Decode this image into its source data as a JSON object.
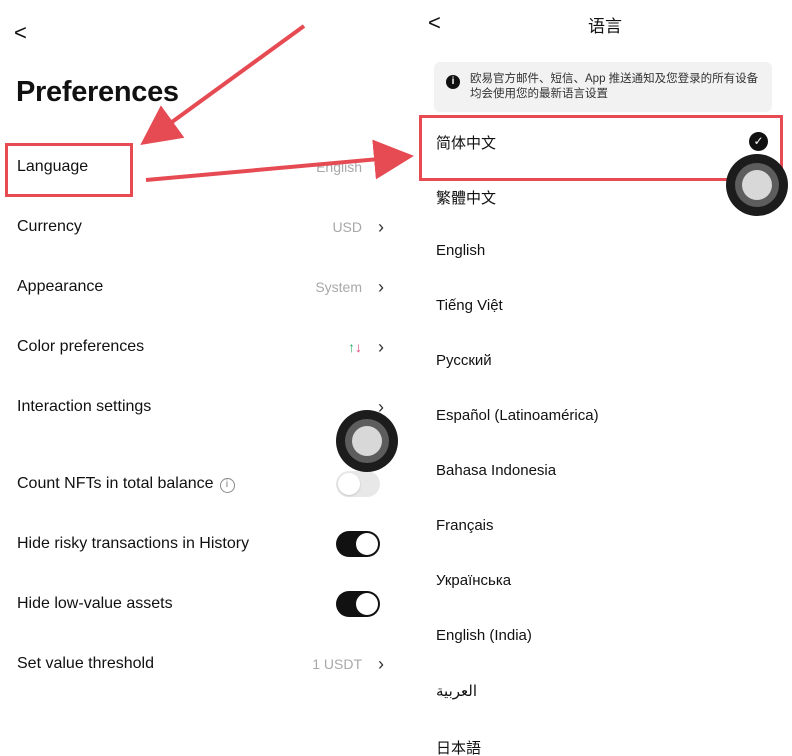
{
  "left": {
    "back_glyph": "<",
    "title": "Preferences",
    "rows": [
      {
        "label": "Language",
        "value": "English"
      },
      {
        "label": "Currency",
        "value": "USD"
      },
      {
        "label": "Appearance",
        "value": "System"
      },
      {
        "label": "Color preferences",
        "value_up": "↑",
        "value_down": "↓"
      },
      {
        "label": "Interaction settings"
      },
      {
        "label": "Count NFTs in total balance",
        "toggle": false
      },
      {
        "label": "Hide risky transactions in History",
        "toggle": true
      },
      {
        "label": "Hide low-value assets",
        "toggle": true
      },
      {
        "label": "Set value threshold",
        "value": "1 USDT"
      }
    ]
  },
  "right": {
    "back_glyph": "<",
    "title": "语言",
    "notice": "欧易官方邮件、短信、App 推送通知及您登录的所有设备均会使用您的最新语言设置",
    "languages": [
      "简体中文",
      "繁體中文",
      "English",
      "Tiếng Việt",
      "Русский",
      "Español (Latinoamérica)",
      "Bahasa Indonesia",
      "Français",
      "Українська",
      "English (India)",
      "العربية",
      "日本語"
    ],
    "selected_language": "简体中文"
  },
  "icons": {
    "chevron_right": "›",
    "info": "i",
    "check": "✓"
  },
  "colors": {
    "highlight": "#e64a52",
    "toggle_on": "#111111",
    "up": "#2bb46a",
    "down": "#e2447b"
  }
}
